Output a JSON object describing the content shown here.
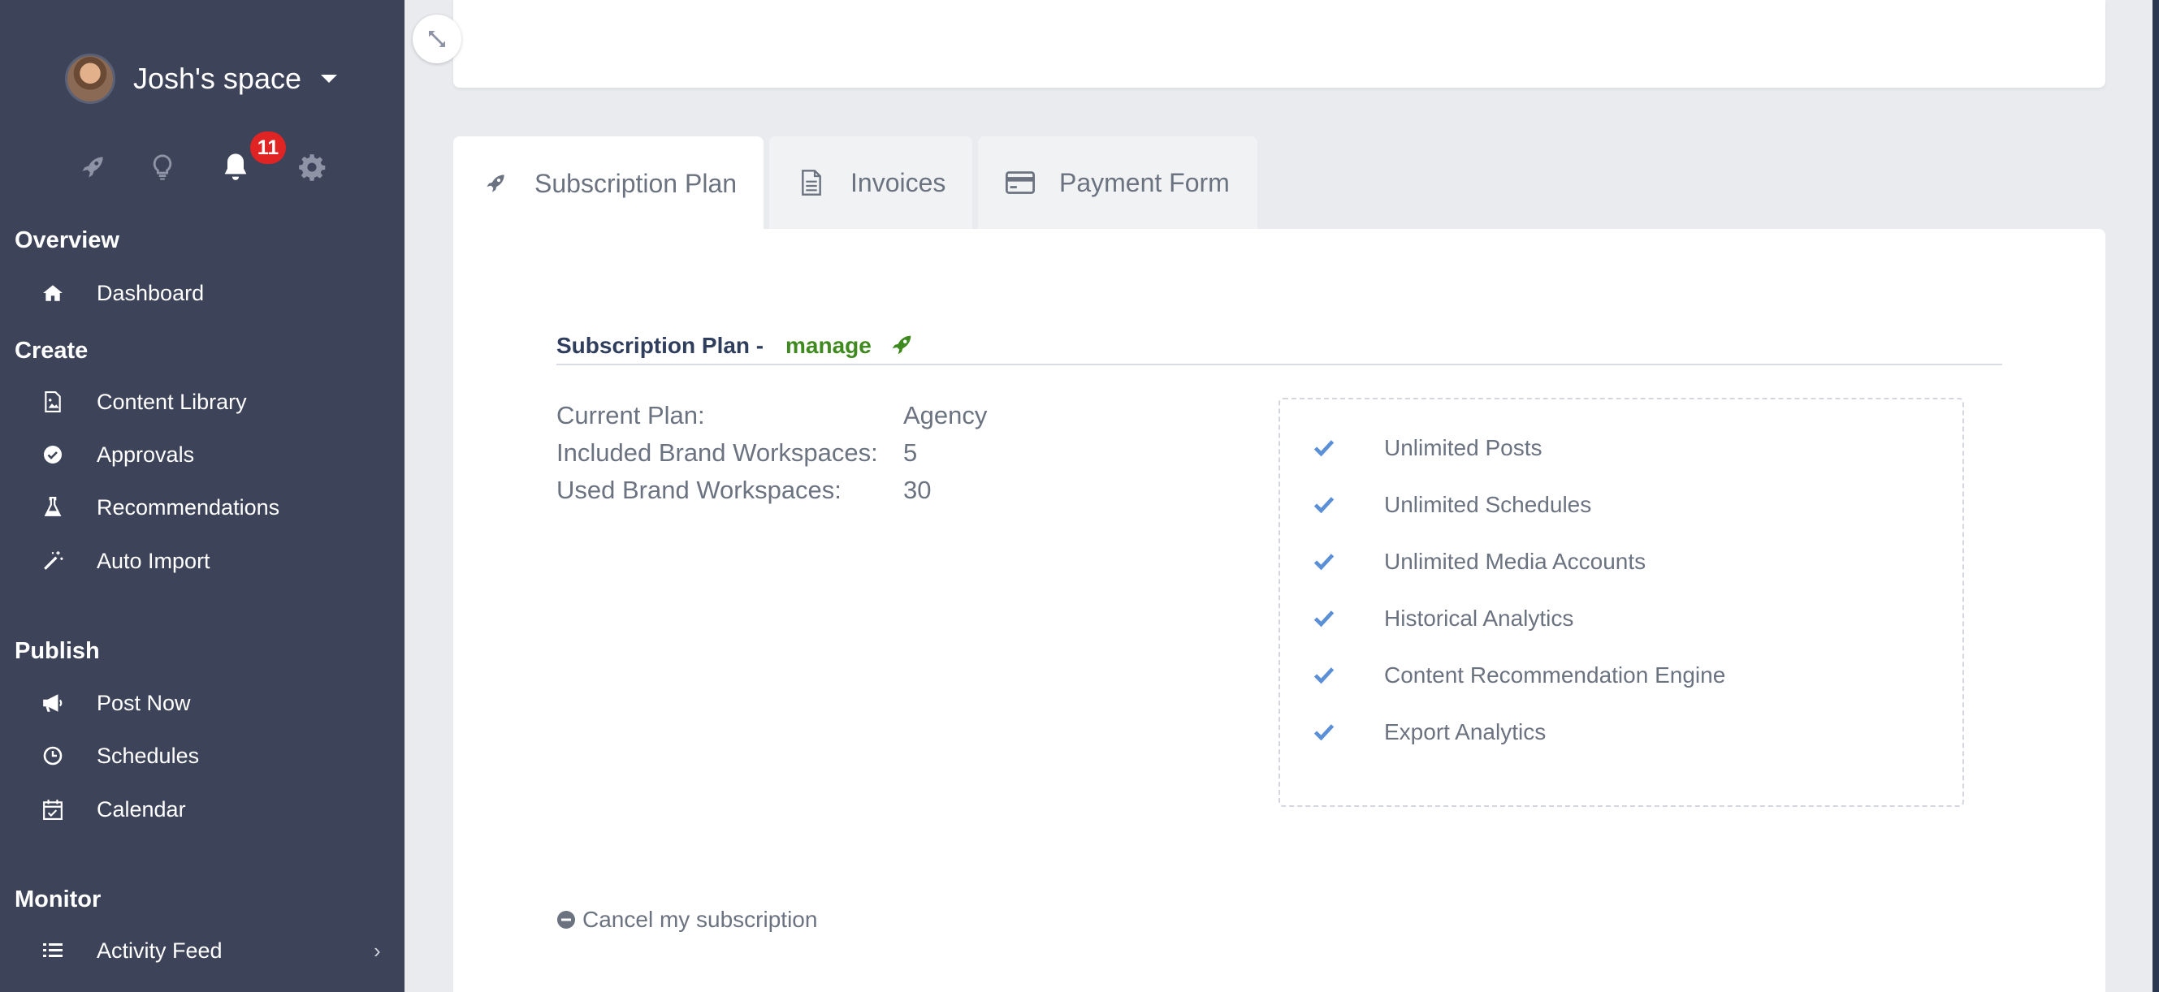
{
  "sidebar": {
    "space_name": "Josh's space",
    "notification_count": "11",
    "quick_icons": [
      "rocket-icon",
      "lightbulb-icon",
      "bell-icon",
      "gear-icon"
    ],
    "sections": {
      "overview": "Overview",
      "create": "Create",
      "publish": "Publish",
      "monitor": "Monitor"
    },
    "items": {
      "dashboard": "Dashboard",
      "content_library": "Content Library",
      "approvals": "Approvals",
      "recommendations": "Recommendations",
      "auto_import": "Auto Import",
      "post_now": "Post Now",
      "schedules": "Schedules",
      "calendar": "Calendar",
      "activity_feed": "Activity Feed"
    }
  },
  "tabs": [
    {
      "label": "Subscription Plan",
      "icon": "rocket-icon",
      "active": true
    },
    {
      "label": "Invoices",
      "icon": "document-icon",
      "active": false
    },
    {
      "label": "Payment Form",
      "icon": "credit-card-icon",
      "active": false
    }
  ],
  "plan": {
    "title": "Subscription Plan -",
    "manage_label": "manage",
    "rows": [
      {
        "key": "Current Plan:",
        "value": "Agency"
      },
      {
        "key": "Included Brand Workspaces:",
        "value": "5"
      },
      {
        "key": "Used Brand Workspaces:",
        "value": "30"
      }
    ],
    "features": [
      "Unlimited Posts",
      "Unlimited Schedules",
      "Unlimited Media Accounts",
      "Historical Analytics",
      "Content Recommendation Engine",
      "Export Analytics"
    ],
    "cancel_label": "Cancel my subscription"
  },
  "colors": {
    "sidebar_bg": "#3d4358",
    "accent_green": "#3f8a1f",
    "check_blue": "#5b8fd6",
    "badge_red": "#e02424"
  }
}
